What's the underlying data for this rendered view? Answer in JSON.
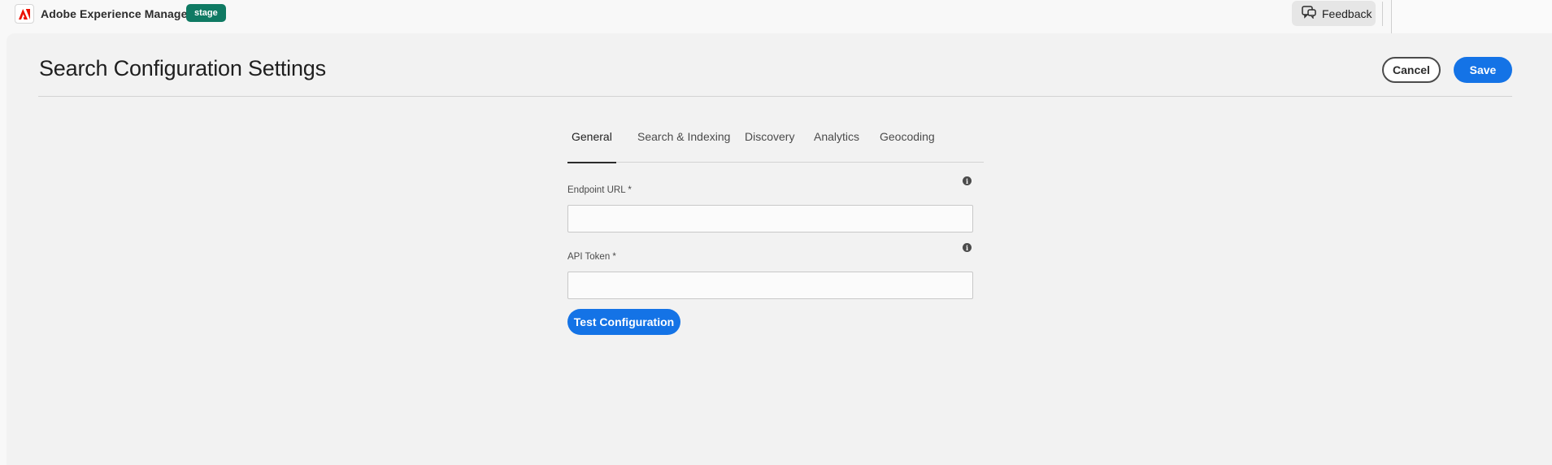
{
  "app": {
    "name": "Adobe Experience Manager",
    "environment": "stage",
    "feedback_label": "Feedback"
  },
  "page": {
    "title": "Search Configuration Settings",
    "cancel_label": "Cancel",
    "save_label": "Save"
  },
  "tabs": [
    {
      "label": "General",
      "active": true
    },
    {
      "label": "Search & Indexing",
      "active": false
    },
    {
      "label": "Discovery",
      "active": false
    },
    {
      "label": "Analytics",
      "active": false
    },
    {
      "label": "Geocoding",
      "active": false
    }
  ],
  "form": {
    "endpoint_url": {
      "label": "Endpoint URL *",
      "value": "",
      "placeholder": ""
    },
    "api_token": {
      "label": "API Token *",
      "value": "",
      "placeholder": ""
    },
    "test_button_label": "Test Configuration"
  },
  "colors": {
    "accent": "#1473e6",
    "environment_badge": "#0f7a63",
    "adobe_red": "#eb1000"
  },
  "icons": {
    "brand": "adobe-logo-icon",
    "feedback": "feedback-chat-icon",
    "field_info": "info-icon"
  }
}
